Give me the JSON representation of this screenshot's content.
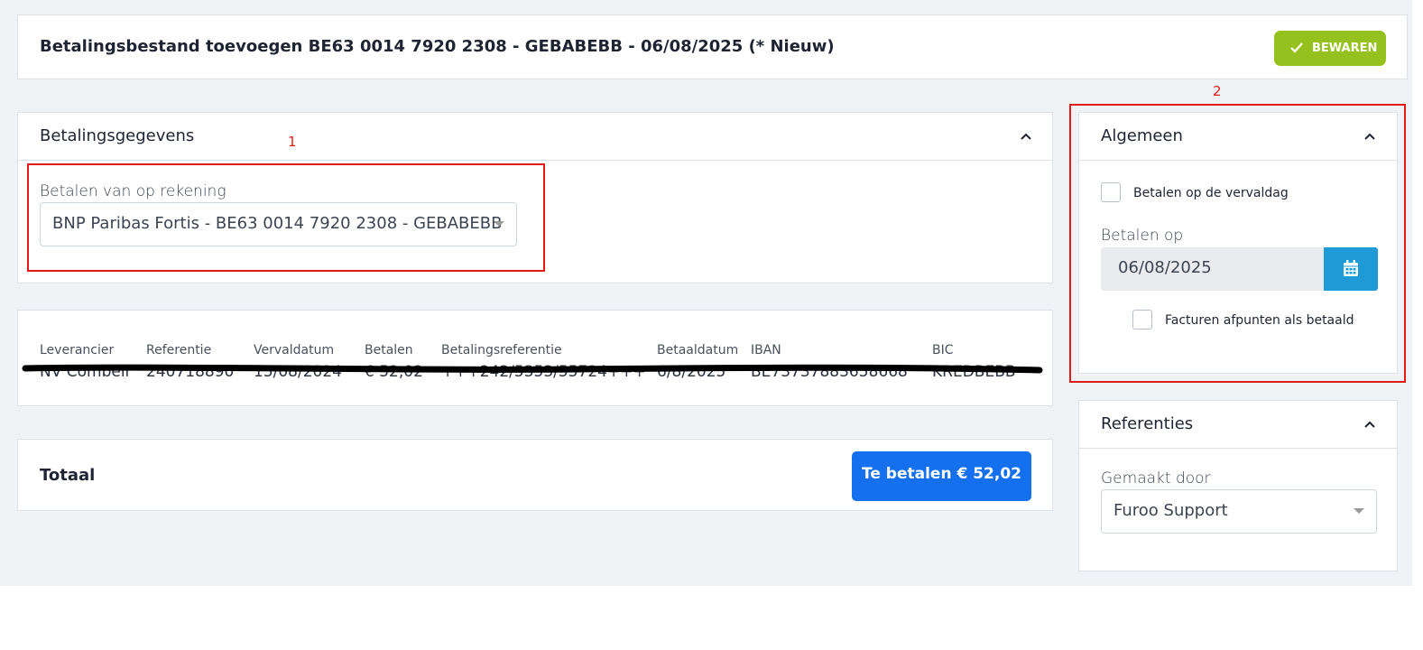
{
  "header": {
    "title": "Betalingsbestand toevoegen BE63 0014 7920 2308 - GEBABEBB - 06/08/2025 (* Nieuw)",
    "save_label": "BEWAREN",
    "save_color": "#95c11f"
  },
  "payment_details": {
    "title": "Betalingsgegevens",
    "account_label": "Betalen van op rekening",
    "account_value": "BNP Paribas Fortis - BE63 0014 7920 2308 - GEBABEBB"
  },
  "table": {
    "columns": [
      "Leverancier",
      "Referentie",
      "Vervaldatum",
      "Betalen",
      "Betalingsreferentie",
      "Betaaldatum",
      "IBAN",
      "BIC"
    ],
    "rows": [
      [
        "NV Combell",
        "240718890",
        "15/08/2024",
        "€ 52,02",
        "+++242/5353/55724+++",
        "6/8/2025",
        "BE73737883658668",
        "KREDBEBB"
      ]
    ]
  },
  "total": {
    "label": "Totaal",
    "pay_button": "Te betalen € 52,02",
    "pay_color": "#1570ef"
  },
  "general": {
    "title": "Algemeen",
    "due_date_checkbox": "Betalen op de vervaldag",
    "pay_on_label": "Betalen op",
    "pay_on_value": "06/08/2025",
    "mark_paid_checkbox": "Facturen afpunten als betaald"
  },
  "references": {
    "title": "Referenties",
    "created_by_label": "Gemaakt door",
    "created_by_value": "Furoo Support"
  },
  "annotations": {
    "box1": "1",
    "box2": "2",
    "color": "#e21b1b"
  }
}
